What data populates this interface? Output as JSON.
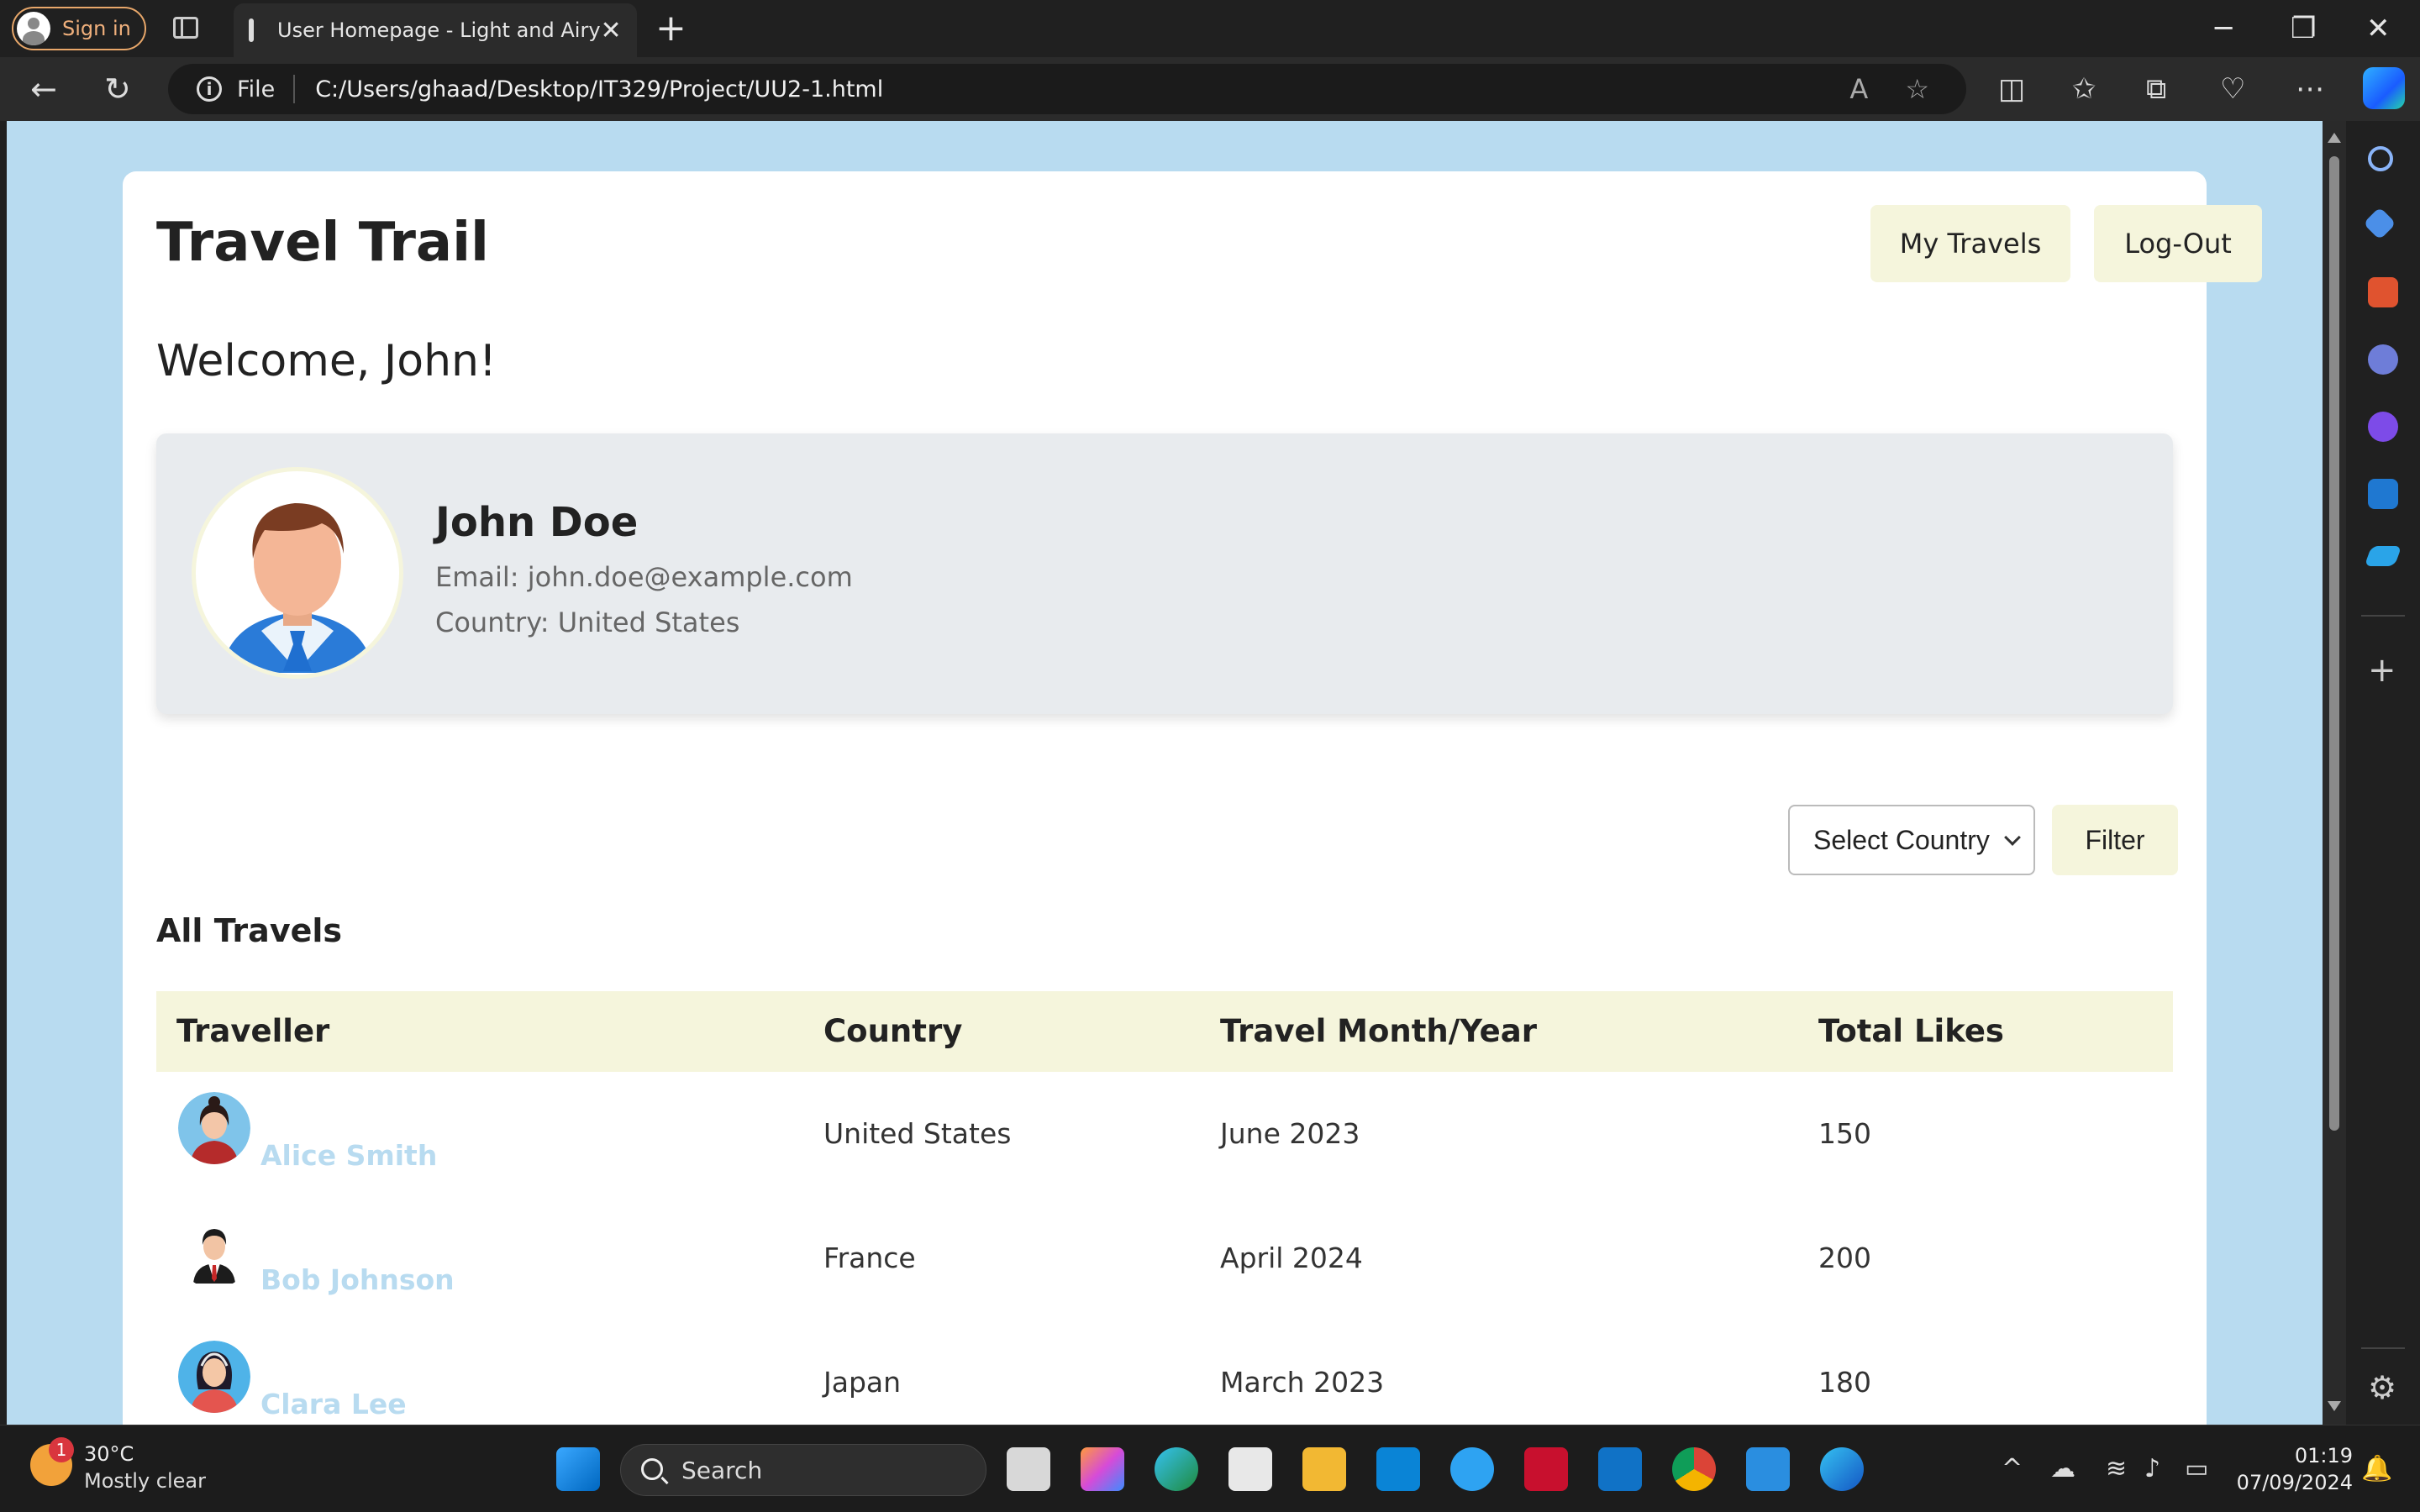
{
  "browser": {
    "signin_label": "Sign in",
    "tab_title": "User Homepage - Light and Airy",
    "tab_close": "✕",
    "new_tab": "+",
    "address_scheme": "File",
    "address_url": "C:/Users/ghaad/Desktop/IT329/Project/UU2-1.html"
  },
  "header": {
    "site_title": "Travel Trail",
    "my_travels_label": "My Travels",
    "logout_label": "Log-Out"
  },
  "welcome": "Welcome, John!",
  "profile": {
    "name": "John Doe",
    "email": "Email: john.doe@example.com",
    "country": "Country: United States"
  },
  "filter": {
    "select_value": "Select Country",
    "button_label": "Filter"
  },
  "travels": {
    "section_title": "All Travels",
    "columns": [
      "Traveller",
      "Country",
      "Travel Month/Year",
      "Total Likes"
    ],
    "rows": [
      {
        "traveller": "Alice Smith",
        "country": "United States",
        "date": "June 2023",
        "likes": "150"
      },
      {
        "traveller": "Bob Johnson",
        "country": "France",
        "date": "April 2024",
        "likes": "200"
      },
      {
        "traveller": "Clara Lee",
        "country": "Japan",
        "date": "March 2023",
        "likes": "180"
      }
    ]
  },
  "colors": {
    "page_background": "#b8dbf0",
    "button_background": "#f5f5dc",
    "card_background": "#ffffff",
    "profile_background": "#e8ebee",
    "traveller_link": "#b8dbf0"
  },
  "taskbar": {
    "temperature": "30°C",
    "condition": "Mostly clear",
    "weather_badge": "1",
    "search_label": "Search",
    "time": "01:19",
    "date": "07/09/2024"
  }
}
